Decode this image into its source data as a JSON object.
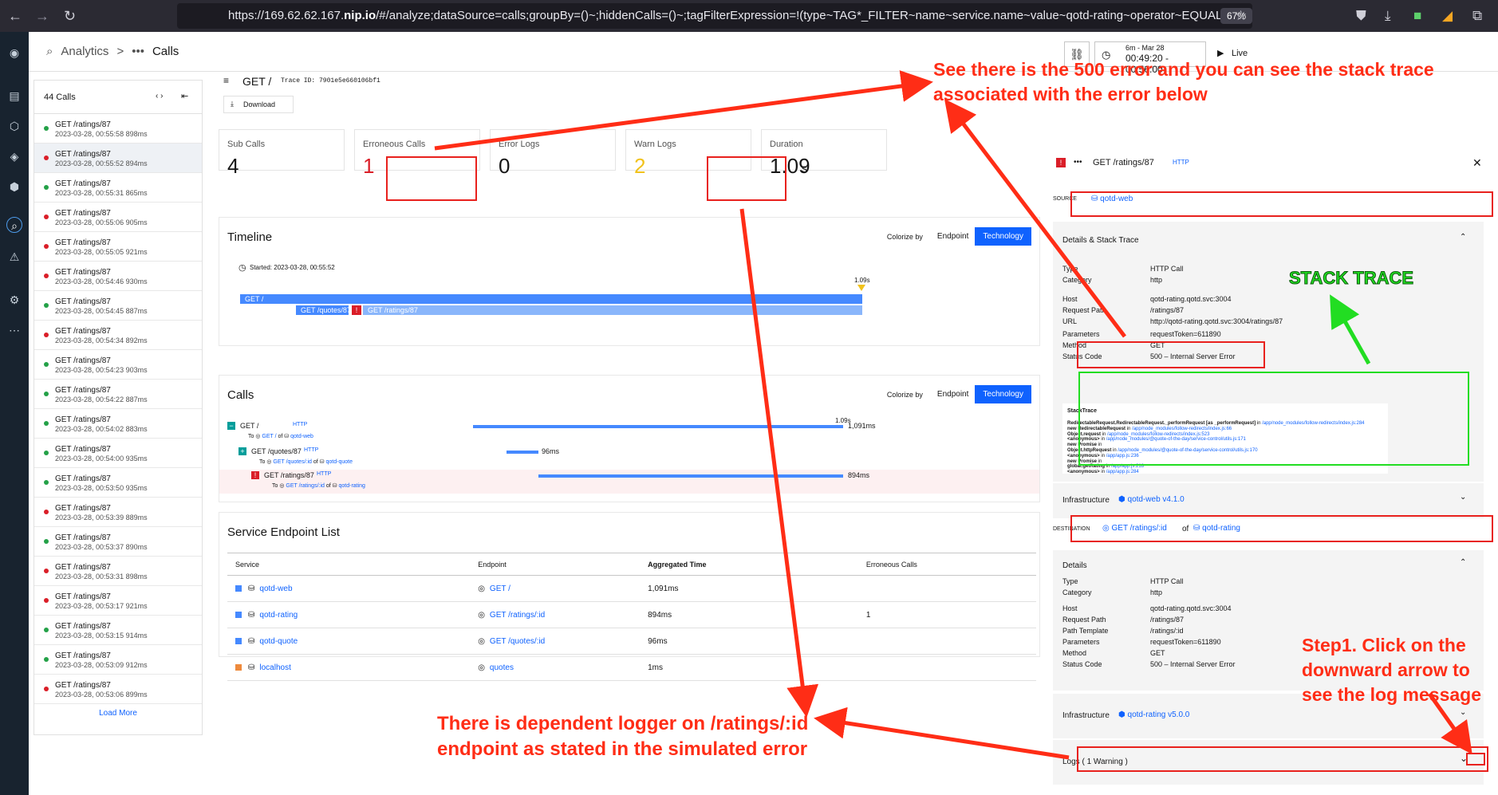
{
  "browser": {
    "url_prefix": "https://169.62.62.167.",
    "url_host": "nip.io",
    "url_rest": "/#/analyze;dataSource=calls;groupBy=()~;hiddenCalls=()~;tagFilterExpression=!(type~TAG*_FILTER~name~service.name~value~qotd-rating~operator~EQUALS~e",
    "zoom": "67%"
  },
  "header": {
    "breadcrumb_root": "Analytics",
    "breadcrumb_sep": ">",
    "breadcrumb_current": "Calls",
    "time_range_top": "6m - Mar 28",
    "time_range": "00:49:20 - 00:56:00",
    "live_label": "Live"
  },
  "call_list": {
    "count": "44 Calls",
    "load_more": "Load More",
    "items": [
      {
        "name": "GET /ratings/87",
        "time": "2023-03-28, 00:55:58",
        "dur": "898ms",
        "status": "ok"
      },
      {
        "name": "GET /ratings/87",
        "time": "2023-03-28, 00:55:52",
        "dur": "894ms",
        "status": "err"
      },
      {
        "name": "GET /ratings/87",
        "time": "2023-03-28, 00:55:31",
        "dur": "865ms",
        "status": "ok"
      },
      {
        "name": "GET /ratings/87",
        "time": "2023-03-28, 00:55:06",
        "dur": "905ms",
        "status": "err"
      },
      {
        "name": "GET /ratings/87",
        "time": "2023-03-28, 00:55:05",
        "dur": "921ms",
        "status": "err"
      },
      {
        "name": "GET /ratings/87",
        "time": "2023-03-28, 00:54:46",
        "dur": "930ms",
        "status": "err"
      },
      {
        "name": "GET /ratings/87",
        "time": "2023-03-28, 00:54:45",
        "dur": "887ms",
        "status": "ok"
      },
      {
        "name": "GET /ratings/87",
        "time": "2023-03-28, 00:54:34",
        "dur": "892ms",
        "status": "err"
      },
      {
        "name": "GET /ratings/87",
        "time": "2023-03-28, 00:54:23",
        "dur": "903ms",
        "status": "ok"
      },
      {
        "name": "GET /ratings/87",
        "time": "2023-03-28, 00:54:22",
        "dur": "887ms",
        "status": "ok"
      },
      {
        "name": "GET /ratings/87",
        "time": "2023-03-28, 00:54:02",
        "dur": "883ms",
        "status": "ok"
      },
      {
        "name": "GET /ratings/87",
        "time": "2023-03-28, 00:54:00",
        "dur": "935ms",
        "status": "ok"
      },
      {
        "name": "GET /ratings/87",
        "time": "2023-03-28, 00:53:50",
        "dur": "935ms",
        "status": "ok"
      },
      {
        "name": "GET /ratings/87",
        "time": "2023-03-28, 00:53:39",
        "dur": "889ms",
        "status": "err"
      },
      {
        "name": "GET /ratings/87",
        "time": "2023-03-28, 00:53:37",
        "dur": "890ms",
        "status": "ok"
      },
      {
        "name": "GET /ratings/87",
        "time": "2023-03-28, 00:53:31",
        "dur": "898ms",
        "status": "err"
      },
      {
        "name": "GET /ratings/87",
        "time": "2023-03-28, 00:53:17",
        "dur": "921ms",
        "status": "err"
      },
      {
        "name": "GET /ratings/87",
        "time": "2023-03-28, 00:53:15",
        "dur": "914ms",
        "status": "ok"
      },
      {
        "name": "GET /ratings/87",
        "time": "2023-03-28, 00:53:09",
        "dur": "912ms",
        "status": "ok"
      },
      {
        "name": "GET /ratings/87",
        "time": "2023-03-28, 00:53:06",
        "dur": "899ms",
        "status": "err"
      }
    ]
  },
  "trace": {
    "title": "GET /",
    "trace_id": "Trace ID: 7901e5e660106bf1",
    "download": "Download"
  },
  "metrics": [
    {
      "label": "Sub Calls",
      "value": "4"
    },
    {
      "label": "Erroneous Calls",
      "value": "1"
    },
    {
      "label": "Error Logs",
      "value": "0"
    },
    {
      "label": "Warn Logs",
      "value": "2"
    },
    {
      "label": "Duration",
      "value": "1.09",
      "unit": "s"
    }
  ],
  "timeline": {
    "title": "Timeline",
    "colorize_label": "Colorize by",
    "endpoint_btn": "Endpoint",
    "technology_btn": "Technology",
    "started": "Started: 2023-03-28, 00:55:52",
    "end_marker": "1.09s",
    "bars": [
      "GET /",
      "GET /quotes/87",
      "GET /ratings/87"
    ]
  },
  "calls": {
    "title": "Calls",
    "marker": "1.09s",
    "rows": [
      {
        "name": "GET /",
        "proto": "HTTP",
        "to": "To",
        "endpoint": "GET /",
        "of": "of",
        "service": "qotd-web",
        "dur": "1,091ms"
      },
      {
        "name": "GET /quotes/87",
        "proto": "HTTP",
        "to": "To",
        "endpoint": "GET /quotes/:id",
        "of": "of",
        "service": "qotd-quote",
        "dur": "96ms"
      },
      {
        "name": "GET /ratings/87",
        "proto": "HTTP",
        "to": "To",
        "endpoint": "GET /ratings/:id",
        "of": "of",
        "service": "qotd-rating",
        "dur": "894ms"
      }
    ]
  },
  "endpoints": {
    "title": "Service Endpoint List",
    "headers": [
      "Service",
      "Endpoint",
      "Aggregated Time",
      "Erroneous Calls"
    ],
    "rows": [
      {
        "service": "qotd-web",
        "endpoint": "GET /",
        "time": "1,091ms",
        "errors": "",
        "color": "#4589ff"
      },
      {
        "service": "qotd-rating",
        "endpoint": "GET /ratings/:id",
        "time": "894ms",
        "errors": "1",
        "color": "#4589ff"
      },
      {
        "service": "qotd-quote",
        "endpoint": "GET /quotes/:id",
        "time": "96ms",
        "errors": "",
        "color": "#4589ff"
      },
      {
        "service": "localhost",
        "endpoint": "quotes",
        "time": "1ms",
        "errors": "",
        "color": "#ee8a3c"
      }
    ]
  },
  "detail": {
    "title": "GET /ratings/87",
    "proto": "HTTP",
    "source_label": "SOURCE",
    "source_value": "qotd-web",
    "details_stack_title": "Details & Stack Trace",
    "source_kv": [
      {
        "k": "Type",
        "v": "HTTP Call"
      },
      {
        "k": "Category",
        "v": "http"
      },
      {
        "k": "Host",
        "v": "qotd-rating.qotd.svc:3004"
      },
      {
        "k": "Request Path",
        "v": "/ratings/87"
      },
      {
        "k": "URL",
        "v": "http://qotd-rating.qotd.svc:3004/ratings/87"
      },
      {
        "k": "Parameters",
        "v": "requestToken=611890"
      },
      {
        "k": "Method",
        "v": "GET"
      },
      {
        "k": "Status Code",
        "v": "500 – Internal Server Error"
      }
    ],
    "stacktrace_title": "StackTrace",
    "stacktrace": [
      {
        "fn": "RedirectableRequest.RedirectableRequest._performRequest [as _performRequest]",
        "loc": "/app/node_modules/follow-redirects/index.js:284"
      },
      {
        "fn": "new RedirectableRequest",
        "loc": "/app/node_modules/follow-redirects/index.js:66"
      },
      {
        "fn": "Object.request",
        "loc": "/app/node_modules/follow-redirects/index.js:523"
      },
      {
        "fn": "<anonymous>",
        "loc": "/app/node_modules/@quote-of-the-day/service-control/utils.js:171"
      },
      {
        "fn": "new Promise",
        "loc": ""
      },
      {
        "fn": "Object.httpRequest",
        "loc": "/app/node_modules/@quote-of-the-day/service-control/utils.js:170"
      },
      {
        "fn": "<anonymous>",
        "loc": "/app/app.js:236"
      },
      {
        "fn": "new Promise",
        "loc": ""
      },
      {
        "fn": "global.getRating",
        "loc": "/app/app.js:218"
      },
      {
        "fn": "<anonymous>",
        "loc": "/app/app.js:284"
      }
    ],
    "infra_label": "Infrastructure",
    "infra_source": "qotd-web v4.1.0",
    "destination_label": "DESTINATION",
    "destination_endpoint": "GET /ratings/:id",
    "destination_of": "of",
    "destination_service": "qotd-rating",
    "details_title": "Details",
    "dest_kv": [
      {
        "k": "Type",
        "v": "HTTP Call"
      },
      {
        "k": "Category",
        "v": "http"
      },
      {
        "k": "Host",
        "v": "qotd-rating.qotd.svc:3004"
      },
      {
        "k": "Request Path",
        "v": "/ratings/87"
      },
      {
        "k": "Path Template",
        "v": "/ratings/:id"
      },
      {
        "k": "Parameters",
        "v": "requestToken=611890"
      },
      {
        "k": "Method",
        "v": "GET"
      },
      {
        "k": "Status Code",
        "v": "500 – Internal Server Error"
      }
    ],
    "infra_dest": "qotd-rating v5.0.0",
    "logs": "Logs ( 1 Warning )"
  },
  "annotations": {
    "top": "See there is the 500 error and you can see the stack trace associated with the error below",
    "stack": "STACK TRACE",
    "step1": "Step1. Click on the downward arrow to see the log message",
    "logger": "There is  dependent logger on /ratings/:id endpoint as stated in the simulated error",
    "colors": {
      "red": "#ff2d16",
      "green": "#22dd22"
    }
  }
}
